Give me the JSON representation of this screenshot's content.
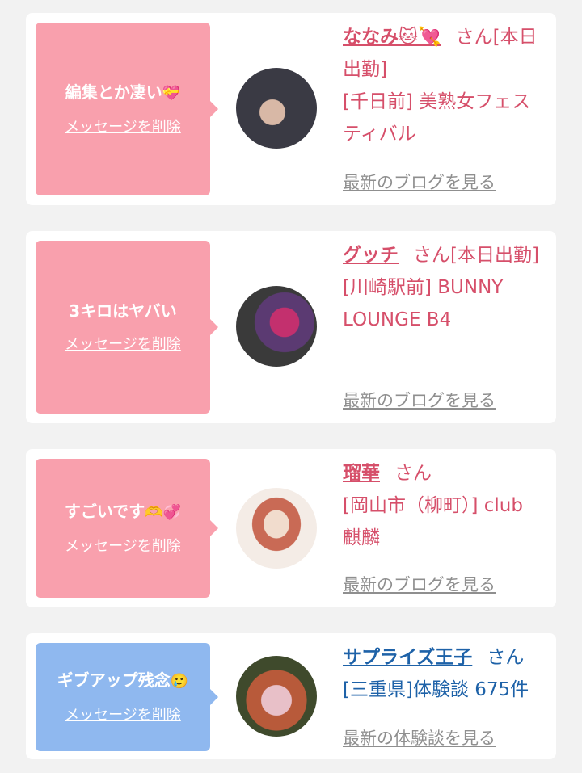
{
  "cards": [
    {
      "message": "編集とか凄い",
      "message_emoji": "💝",
      "delete_label": "メッセージを削除",
      "name": "ななみ",
      "name_emoji": "🐱💘",
      "san": "さん",
      "status": "[本日出勤]",
      "shop": "[千日前] 美熟女フェスティバル",
      "link": "最新のブログを見る"
    },
    {
      "message": "3キロはヤバい",
      "message_emoji": "",
      "delete_label": "メッセージを削除",
      "name": "グッチ",
      "name_emoji": "",
      "san": "さん",
      "status": "[本日出勤]",
      "shop": "[川崎駅前] BUNNY LOUNGE B4",
      "link": "最新のブログを見る"
    },
    {
      "message": "すごいです",
      "message_emoji": "🫶💞",
      "delete_label": "メッセージを削除",
      "name": "瑠華",
      "name_emoji": "",
      "san": "さん",
      "status": "",
      "shop": "[岡山市（柳町）] club 麒麟",
      "link": "最新のブログを見る"
    },
    {
      "message": "ギブアップ残念",
      "message_emoji": "🥲",
      "delete_label": "メッセージを削除",
      "name": "サプライズ王子",
      "name_emoji": "",
      "san": "さん",
      "status": "",
      "shop": "[三重県]体験談 675件",
      "link": "最新の体験談を見る"
    }
  ],
  "colors": {
    "pink_bubble": "#f9a0ad",
    "blue_bubble": "#8fb8ef",
    "cast_text": "#d64f6a",
    "user_text": "#1e62a8",
    "link_gray": "#8f8f8f"
  }
}
